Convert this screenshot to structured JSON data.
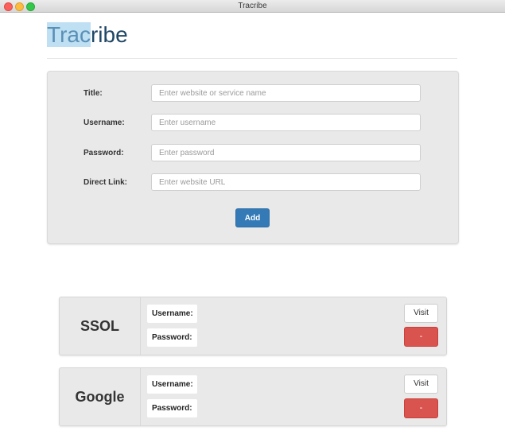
{
  "window": {
    "title": "Tracribe",
    "controls": [
      "close",
      "minimize",
      "zoom"
    ]
  },
  "header": {
    "logo_selected": "Trac",
    "logo_rest": "ribe"
  },
  "form": {
    "title_label": "Title:",
    "title_placeholder": "Enter website or service name",
    "title_value": "",
    "username_label": "Username:",
    "username_placeholder": "Enter username",
    "username_value": "",
    "password_label": "Password:",
    "password_placeholder": "Enter password",
    "password_value": "",
    "link_label": "Direct Link:",
    "link_placeholder": "Enter website URL",
    "link_value": "",
    "add_label": "Add"
  },
  "entries": [
    {
      "name": "SSOL",
      "username_label": "Username:",
      "password_label": "Password:",
      "visit_label": "Visit",
      "remove_label": "-"
    },
    {
      "name": "Google",
      "username_label": "Username:",
      "password_label": "Password:",
      "visit_label": "Visit",
      "remove_label": "-"
    }
  ],
  "colors": {
    "brand": "#1f4766",
    "primary_button": "#337ab7",
    "danger_button": "#d9534f",
    "panel_bg": "#e9e9e9"
  }
}
